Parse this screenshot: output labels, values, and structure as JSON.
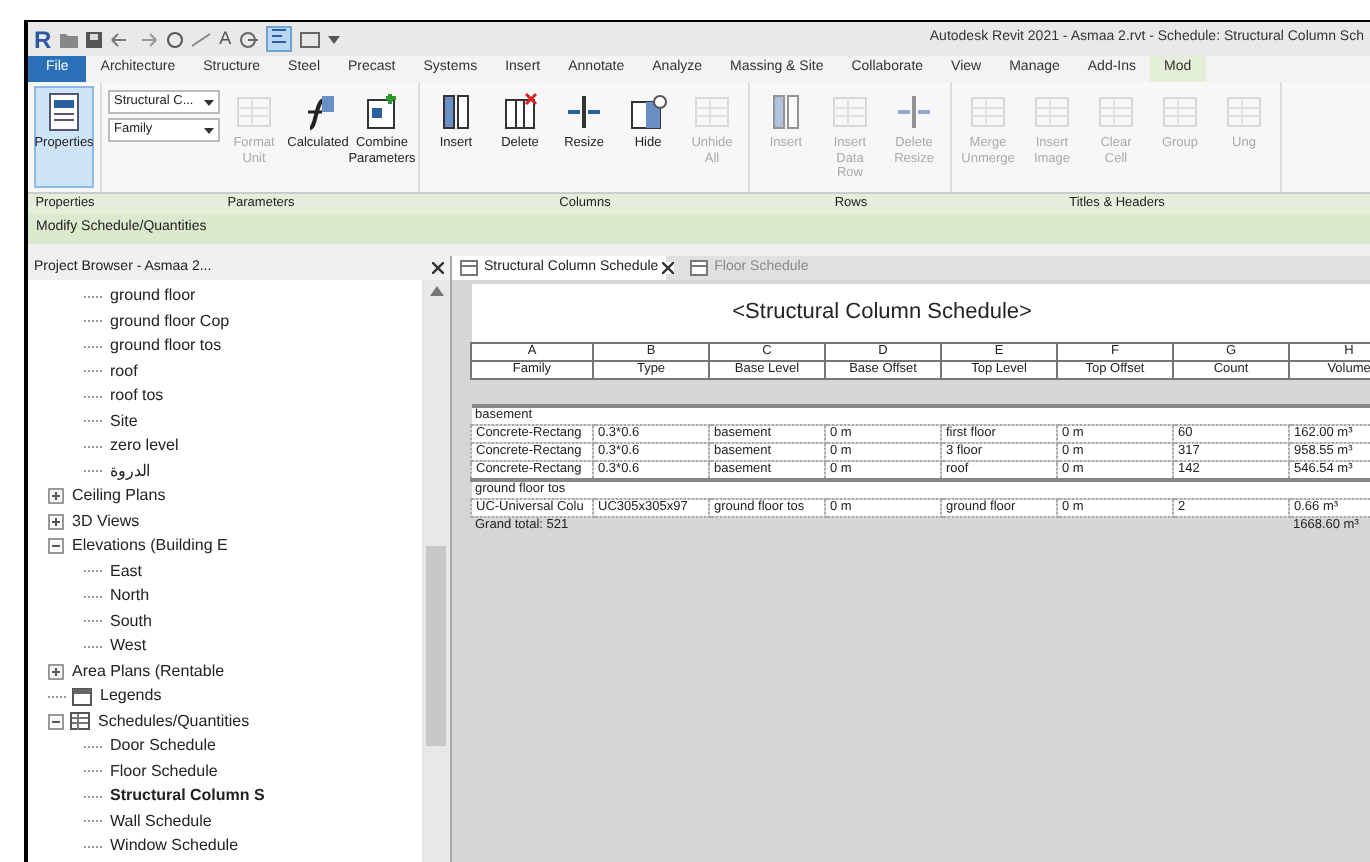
{
  "title_bar": {
    "app_logo": "R",
    "text_tool_glyph": "A",
    "thin_lines_on": true,
    "title": "Autodesk Revit 2021 - Asmaa 2.rvt - Schedule: Structural Column Sch"
  },
  "ribbon_tabs": [
    {
      "label": "File",
      "kind": "file",
      "selected": false
    },
    {
      "label": "Architecture",
      "kind": "tab",
      "selected": false
    },
    {
      "label": "Structure",
      "kind": "tab",
      "selected": false
    },
    {
      "label": "Steel",
      "kind": "tab",
      "selected": false
    },
    {
      "label": "Precast",
      "kind": "tab",
      "selected": false
    },
    {
      "label": "Systems",
      "kind": "tab",
      "selected": false
    },
    {
      "label": "Insert",
      "kind": "tab",
      "selected": false
    },
    {
      "label": "Annotate",
      "kind": "tab",
      "selected": false
    },
    {
      "label": "Analyze",
      "kind": "tab",
      "selected": false
    },
    {
      "label": "Massing & Site",
      "kind": "tab",
      "selected": false
    },
    {
      "label": "Collaborate",
      "kind": "tab",
      "selected": false
    },
    {
      "label": "View",
      "kind": "tab",
      "selected": false
    },
    {
      "label": "Manage",
      "kind": "tab",
      "selected": false
    },
    {
      "label": "Add-Ins",
      "kind": "tab",
      "selected": false
    },
    {
      "label": "Mod",
      "kind": "tab",
      "selected": true
    }
  ],
  "ribbon_panels": [
    {
      "title": "Properties",
      "items": [
        {
          "kind": "big",
          "label": "Properties",
          "selected": true,
          "disabled": false
        }
      ]
    },
    {
      "title": "Parameters",
      "items": [
        {
          "kind": "dropdowns",
          "values": [
            "Structural C...",
            "Family"
          ]
        },
        {
          "kind": "big",
          "label": "Format Unit",
          "selected": false,
          "disabled": true
        },
        {
          "kind": "big",
          "label": "Calculated",
          "selected": false,
          "disabled": false
        },
        {
          "kind": "big",
          "label": "Combine Parameters",
          "selected": false,
          "disabled": false
        }
      ]
    },
    {
      "title": "Columns",
      "items": [
        {
          "kind": "big",
          "label": "Insert",
          "selected": false,
          "disabled": false
        },
        {
          "kind": "big",
          "label": "Delete",
          "selected": false,
          "disabled": false
        },
        {
          "kind": "big",
          "label": "Resize",
          "selected": false,
          "disabled": false
        },
        {
          "kind": "big",
          "label": "Hide",
          "selected": false,
          "disabled": false
        },
        {
          "kind": "big",
          "label": "Unhide All",
          "selected": false,
          "disabled": true
        }
      ]
    },
    {
      "title": "Rows",
      "items": [
        {
          "kind": "big",
          "label": "Insert",
          "selected": false,
          "disabled": true
        },
        {
          "kind": "big",
          "label": "Insert Data Row",
          "selected": false,
          "disabled": true
        },
        {
          "kind": "big",
          "label": "Delete Resize",
          "selected": false,
          "disabled": true
        }
      ]
    },
    {
      "title": "Titles & Headers",
      "items": [
        {
          "kind": "big",
          "label": "Merge Unmerge",
          "selected": false,
          "disabled": true
        },
        {
          "kind": "big",
          "label": "Insert Image",
          "selected": false,
          "disabled": true
        },
        {
          "kind": "big",
          "label": "Clear Cell",
          "selected": false,
          "disabled": true
        },
        {
          "kind": "big",
          "label": "Group",
          "selected": false,
          "disabled": true
        },
        {
          "kind": "big",
          "label": "Ung",
          "selected": false,
          "disabled": true
        }
      ]
    }
  ],
  "context_bar": "Modify Schedule/Quantities",
  "project_browser": {
    "title": "Project Browser - Asmaa 2...",
    "scrolled_parent_children": [
      {
        "label": "ground floor",
        "selected": false
      },
      {
        "label": "ground floor Cop",
        "selected": false
      },
      {
        "label": "ground floor tos",
        "selected": false
      },
      {
        "label": "roof",
        "selected": false
      },
      {
        "label": "roof tos",
        "selected": false
      },
      {
        "label": "Site",
        "selected": false
      },
      {
        "label": "zero level",
        "selected": false
      },
      {
        "label": "الدروة",
        "selected": false
      }
    ],
    "tree": [
      {
        "label": "Ceiling Plans",
        "expanded": false,
        "selected": false
      },
      {
        "label": "3D Views",
        "expanded": false,
        "selected": false
      },
      {
        "label": "Elevations (Building E",
        "expanded": true,
        "selected": false,
        "children": [
          {
            "label": "East",
            "selected": false
          },
          {
            "label": "North",
            "selected": false
          },
          {
            "label": "South",
            "selected": false
          },
          {
            "label": "West",
            "selected": false
          }
        ]
      },
      {
        "label": "Area Plans (Rentable",
        "expanded": false,
        "selected": false
      },
      {
        "label": "Legends",
        "kind": "legend",
        "selected": false
      },
      {
        "label": "Schedules/Quantities",
        "kind": "schedule",
        "expanded": true,
        "selected": false,
        "children": [
          {
            "label": "Door Schedule",
            "selected": false
          },
          {
            "label": "Floor Schedule",
            "selected": false
          },
          {
            "label": "Structural Column S",
            "selected": true
          },
          {
            "label": "Wall Schedule",
            "selected": false
          },
          {
            "label": "Window Schedule",
            "selected": false
          }
        ]
      }
    ]
  },
  "view_tabs": [
    {
      "label": "Structural Column Schedule",
      "selected": true,
      "closable": true
    },
    {
      "label": "Floor Schedule",
      "selected": false,
      "closable": false
    }
  ],
  "schedule": {
    "title": "<Structural Column Schedule>",
    "columns": [
      {
        "letter": "A",
        "heading": "Family"
      },
      {
        "letter": "B",
        "heading": "Type"
      },
      {
        "letter": "C",
        "heading": "Base Level"
      },
      {
        "letter": "D",
        "heading": "Base Offset"
      },
      {
        "letter": "E",
        "heading": "Top Level"
      },
      {
        "letter": "F",
        "heading": "Top Offset"
      },
      {
        "letter": "G",
        "heading": "Count"
      },
      {
        "letter": "H",
        "heading": "Volume"
      }
    ],
    "groups": [
      {
        "title": "basement",
        "rows": [
          [
            "Concrete-Rectang",
            "0.3*0.6",
            "basement",
            "0 m",
            "first floor",
            "0 m",
            "60",
            "162.00 m³"
          ],
          [
            "Concrete-Rectang",
            "0.3*0.6",
            "basement",
            "0 m",
            "3 floor",
            "0 m",
            "317",
            "958.55 m³"
          ],
          [
            "Concrete-Rectang",
            "0.3*0.6",
            "basement",
            "0 m",
            "roof",
            "0 m",
            "142",
            "546.54 m³"
          ]
        ]
      },
      {
        "title": "ground floor tos",
        "rows": [
          [
            "UC-Universal Colu",
            "UC305x305x97",
            "ground floor tos",
            "0 m",
            "ground floor",
            "0 m",
            "2",
            "0.66 m³"
          ]
        ]
      }
    ],
    "grand_total": {
      "label": "Grand total: 521",
      "volume": "1668.60 m³"
    }
  }
}
